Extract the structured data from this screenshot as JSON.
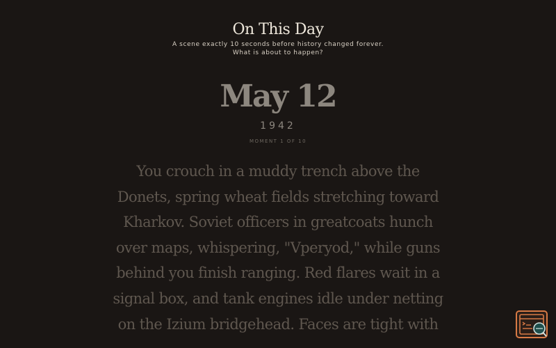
{
  "header": {
    "title": "On This Day",
    "subtitle_line1": "A scene exactly 10 seconds before history changed forever.",
    "subtitle_line2": "What is about to happen?"
  },
  "date": {
    "main": "May 12",
    "year": "1942",
    "moment": "MOMENT 1 OF 10"
  },
  "story": {
    "text": "You crouch in a muddy trench above the Donets, spring wheat fields stretching toward Kharkov. Soviet officers in greatcoats hunch over maps, whispering, \"Vperyod,\" while guns behind you finish ranging. Red flares wait in a signal box, and tank engines idle under netting on the Izium bridgehead. Faces are tight with"
  },
  "fab": {
    "icon": "terminal-search-icon",
    "accent_color": "#d87a45",
    "secondary_color": "#2a6e6a"
  }
}
